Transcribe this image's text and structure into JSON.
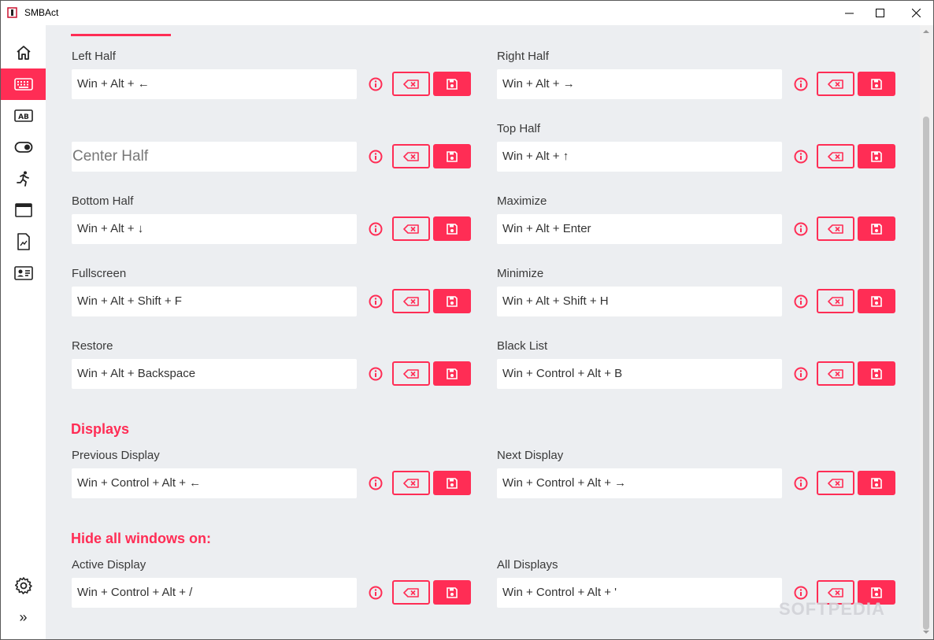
{
  "window": {
    "title": "SMBAct"
  },
  "sidebar": {
    "items": [
      {
        "name": "home-icon"
      },
      {
        "name": "keyboard-icon"
      },
      {
        "name": "ab-icon"
      },
      {
        "name": "toggle-icon"
      },
      {
        "name": "runner-icon"
      },
      {
        "name": "window-icon"
      },
      {
        "name": "document-icon"
      },
      {
        "name": "contact-card-icon"
      }
    ],
    "bottom": [
      {
        "name": "gear-icon"
      },
      {
        "name": "expand-icon",
        "glyph": "»"
      }
    ]
  },
  "snapping": {
    "left_half": {
      "label": "Left Half",
      "value": "Win + Alt + ←"
    },
    "right_half": {
      "label": "Right Half",
      "value": "Win + Alt + →"
    },
    "center_half": {
      "label": "",
      "placeholder": "Center Half"
    },
    "top_half": {
      "label": "Top Half",
      "value": "Win + Alt + ↑"
    },
    "bottom_half": {
      "label": "Bottom Half",
      "value": "Win + Alt + ↓"
    },
    "maximize": {
      "label": "Maximize",
      "value": "Win + Alt + Enter"
    },
    "fullscreen": {
      "label": "Fullscreen",
      "value": "Win + Alt + Shift + F"
    },
    "minimize": {
      "label": "Minimize",
      "value": "Win + Alt + Shift + H"
    },
    "restore": {
      "label": "Restore",
      "value": "Win + Alt + Backspace"
    },
    "black_list": {
      "label": "Black List",
      "value": "Win + Control + Alt + B"
    }
  },
  "displays": {
    "title": "Displays",
    "previous": {
      "label": "Previous Display",
      "value": "Win + Control + Alt + ←"
    },
    "next": {
      "label": "Next Display",
      "value": "Win + Control + Alt + →"
    }
  },
  "hide_all": {
    "title": "Hide all windows on:",
    "active": {
      "label": "Active Display",
      "value": "Win + Control + Alt + /"
    },
    "all": {
      "label": "All Displays",
      "value": "Win + Control + Alt + '"
    }
  },
  "watermark": "SOFTPEDIA",
  "colors": {
    "accent": "#ff2d55",
    "background": "#eceef1",
    "sidebar": "#ffffff"
  }
}
